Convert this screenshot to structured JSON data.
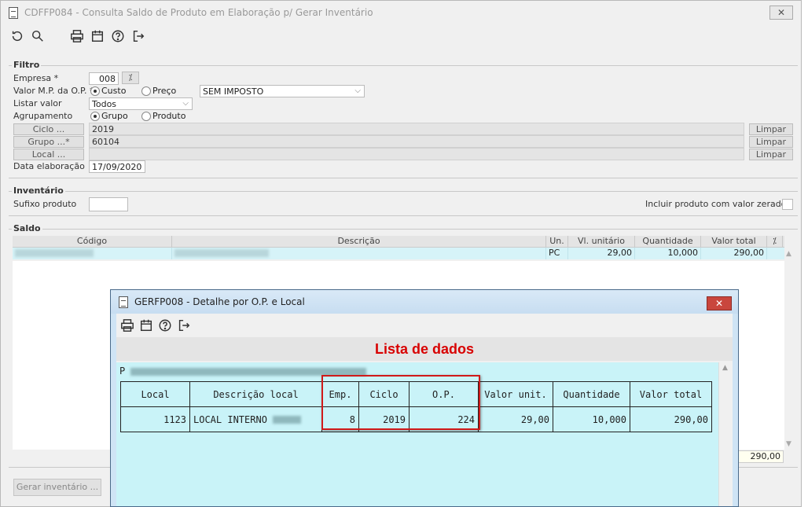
{
  "window": {
    "title": "CDFFP084 - Consulta Saldo de Produto em Elaboração p/ Gerar Inventário",
    "close_glyph": "✕"
  },
  "toolbar": {
    "icons": [
      "refresh-icon",
      "search-icon",
      "print-icon",
      "calendar-icon",
      "help-icon",
      "exit-icon"
    ]
  },
  "filtro": {
    "legend": "Filtro",
    "empresa_label": "Empresa *",
    "empresa_value": "008",
    "valor_mp_label": "Valor M.P. da O.P. *",
    "radio_custo": "Custo",
    "radio_preco": "Preço",
    "imposto_select": "SEM IMPOSTO",
    "listar_label": "Listar valor",
    "listar_select": "Todos",
    "agrupamento_label": "Agrupamento",
    "radio_grupo": "Grupo",
    "radio_produto": "Produto",
    "ciclo_btn": "Ciclo ...",
    "ciclo_value": "2019",
    "grupo_btn": "Grupo ...*",
    "grupo_value": "60104",
    "local_btn": "Local ...",
    "local_value": "",
    "limpar": "Limpar",
    "data_label": "Data elaboração",
    "data_value": "17/09/2020"
  },
  "inventario": {
    "legend": "Inventário",
    "sufixo_label": "Sufixo produto",
    "sufixo_value": "",
    "incluir_label": "Incluir produto com valor zerado"
  },
  "saldo": {
    "legend": "Saldo",
    "columns": [
      "Código",
      "Descrição",
      "Un.",
      "Vl. unitário",
      "Quantidade",
      "Valor total"
    ],
    "row": {
      "un": "PC",
      "vl_unit": "29,00",
      "quantidade": "10,000",
      "valor_total": "290,00"
    },
    "total": "290,00"
  },
  "gerar_button": "Gerar inventário ...",
  "modal": {
    "title": "GERFP008 - Detalhe por O.P. e Local",
    "close_glyph": "✕",
    "header": "Lista de dados",
    "prefix_char": "P",
    "columns": [
      "Local",
      "Descrição local",
      "Emp.",
      "Ciclo",
      "O.P.",
      "Valor unit.",
      "Quantidade",
      "Valor total"
    ],
    "row": [
      "1123",
      "LOCAL INTERNO",
      "8",
      "2019",
      "224",
      "29,00",
      "10,000",
      "290,00"
    ]
  }
}
